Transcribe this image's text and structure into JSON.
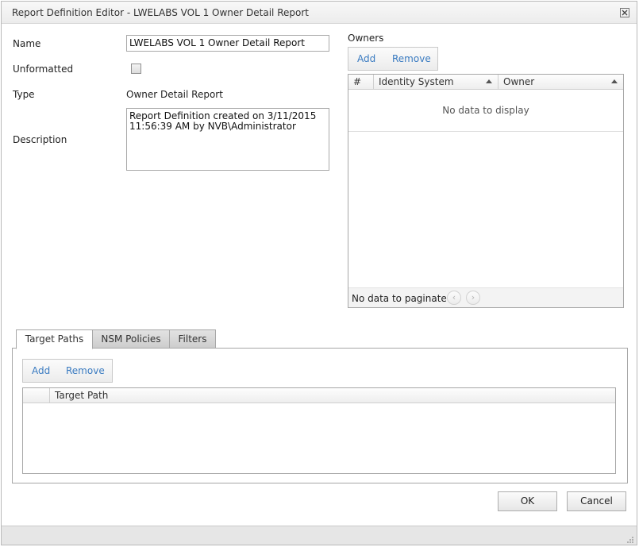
{
  "window": {
    "title": "Report Definition Editor - LWELABS VOL 1 Owner Detail Report"
  },
  "form": {
    "name_label": "Name",
    "name_value": "LWELABS VOL 1 Owner Detail Report",
    "unformatted_label": "Unformatted",
    "unformatted_checked": false,
    "type_label": "Type",
    "type_value": "Owner Detail Report",
    "description_label": "Description",
    "description_value": "Report Definition created on 3/11/2015\n11:56:39 AM by NVB\\Administrator"
  },
  "owners": {
    "label": "Owners",
    "add_label": "Add",
    "remove_label": "Remove",
    "columns": [
      "#",
      "Identity System",
      "Owner"
    ],
    "empty_text": "No data to display",
    "pager_text": "No data to paginate",
    "pager_prev": "‹",
    "pager_next": "›"
  },
  "tabs": {
    "items": [
      {
        "label": "Target Paths",
        "active": true
      },
      {
        "label": "NSM Policies",
        "active": false
      },
      {
        "label": "Filters",
        "active": false
      }
    ],
    "target_paths": {
      "add_label": "Add",
      "remove_label": "Remove",
      "columns": [
        "",
        "Target Path"
      ]
    }
  },
  "footer": {
    "ok_label": "OK",
    "cancel_label": "Cancel"
  },
  "colors": {
    "link": "#3a7bc1",
    "border": "#a7a7a7",
    "tab_inactive": "#d4d4d4"
  },
  "icons": {
    "close": "close-icon",
    "sort": "sort-ascending-icon",
    "resize": "resize-grip-icon"
  }
}
